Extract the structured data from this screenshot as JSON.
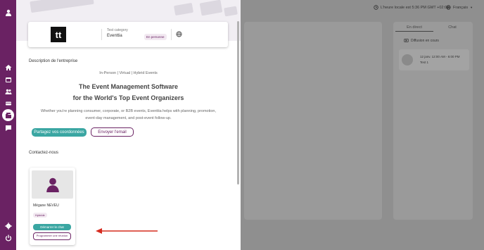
{
  "topbar": {
    "local_time": "L'heure locale est 5:36 PM GMT +02:00",
    "language": "Français"
  },
  "right_panel": {
    "tabs": [
      "En direct",
      "Chat"
    ],
    "diffusion_label": "Diffusion en cours",
    "event_time": "12 janv. 12:00 AM - 6:00 PM",
    "event_name": "Test 1"
  },
  "organization": {
    "logo_text": "tt",
    "category": "Test category",
    "name": "Eventtia",
    "badge": "En personne"
  },
  "description": {
    "heading": "Description de l'entreprise",
    "tagline": "In-Person | Virtual | Hybrid Events",
    "title_line1": "The Event Management Software",
    "title_line2": "for the World's Top Event Organizers",
    "paragraph": "Whether you're planning consumer, corporate, or B2B events, Eventtia helps with planning, promotion, event-day management, and post-event follow-up."
  },
  "actions": {
    "share_label": "Partagez vos coordonnées",
    "email_label": "Envoyer l'email"
  },
  "contacts": {
    "heading": "Contactez-nous",
    "items": [
      {
        "name": "Mégane NEVEU",
        "badge": "Hybride",
        "chat_label": "Démarrer le chat",
        "meeting_label": "Programmer une réunion"
      }
    ]
  },
  "colors": {
    "brand_purple": "#6a2263",
    "teal": "#3aa6a2",
    "arrow_red": "#d62b1f"
  },
  "icons": [
    "user-icon",
    "home-icon",
    "calendar-icon",
    "people-icon",
    "ticket-icon",
    "exhibitors-icon",
    "chat-icon",
    "gear-icon",
    "power-icon",
    "clock-icon",
    "globe-icon",
    "broadcast-icon"
  ]
}
